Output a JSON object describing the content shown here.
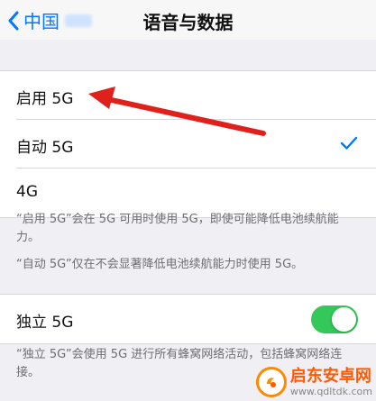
{
  "nav": {
    "back_label": "中国",
    "title": "语音与数据"
  },
  "options": [
    {
      "label": "启用 5G",
      "selected": false
    },
    {
      "label": "自动 5G",
      "selected": true
    },
    {
      "label": "4G",
      "selected": false
    }
  ],
  "footnotes": {
    "enable_5g": "“启用 5G”会在 5G 可用时使用 5G，即使可能降低电池续航能力。",
    "auto_5g": "“自动 5G”仅在不会显著降低电池续航能力时使用 5G。",
    "standalone_5g": "“独立 5G”会使用 5G 进行所有蜂窝网络活动，包括蜂窝网络连接。"
  },
  "standalone": {
    "label": "独立 5G",
    "enabled": true
  },
  "colors": {
    "accent": "#007aff",
    "toggle_on": "#34c759",
    "annotation_arrow": "#e0211b"
  },
  "watermark": {
    "title": "启东安卓网",
    "url": "www.qdltdk.com"
  }
}
